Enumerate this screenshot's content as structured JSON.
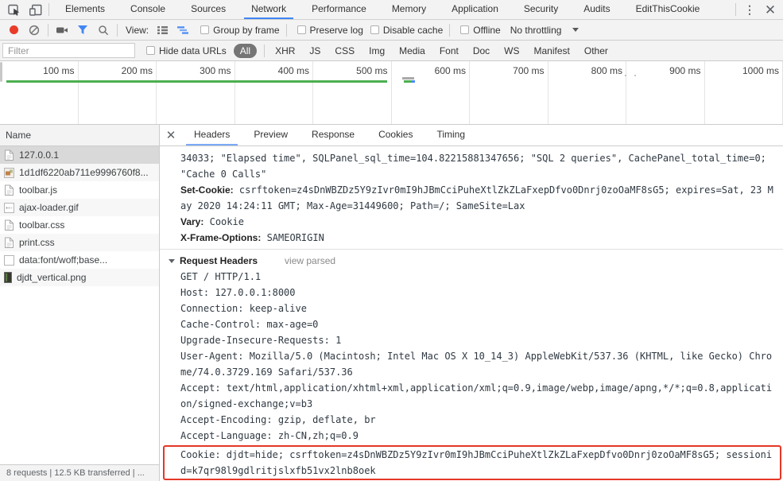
{
  "colors": {
    "accent_blue": "#4285f4",
    "record_red": "#e93b28",
    "overview_green": "#4caf50",
    "highlight_red": "#e53727",
    "selection_grey": "#d9d9d9"
  },
  "main_tabs": {
    "active": "Network",
    "items": [
      {
        "label": "Elements"
      },
      {
        "label": "Console"
      },
      {
        "label": "Sources"
      },
      {
        "label": "Network"
      },
      {
        "label": "Performance"
      },
      {
        "label": "Memory"
      },
      {
        "label": "Application"
      },
      {
        "label": "Security"
      },
      {
        "label": "Audits"
      },
      {
        "label": "EditThisCookie"
      }
    ]
  },
  "toolbar": {
    "view_label": "View:",
    "group_by_frame": "Group by frame",
    "preserve_log": "Preserve log",
    "disable_cache": "Disable cache",
    "offline": "Offline",
    "throttling": "No throttling"
  },
  "filter": {
    "placeholder": "Filter",
    "hide_data_urls": "Hide data URLs",
    "all_badge": "All",
    "types": [
      "XHR",
      "JS",
      "CSS",
      "Img",
      "Media",
      "Font",
      "Doc",
      "WS",
      "Manifest",
      "Other"
    ]
  },
  "timeline": {
    "ticks": [
      "100 ms",
      "200 ms",
      "300 ms",
      "400 ms",
      "500 ms",
      "600 ms",
      "700 ms",
      "800 ms",
      "900 ms",
      "1000 ms"
    ]
  },
  "request_list": {
    "header": "Name",
    "rows": [
      {
        "name": "127.0.0.1",
        "icon": "document-icon",
        "selected": true
      },
      {
        "name": "1d1df6220ab711e9996760f8...",
        "icon": "image-icon",
        "selected": false
      },
      {
        "name": "toolbar.js",
        "icon": "document-icon",
        "selected": false
      },
      {
        "name": "ajax-loader.gif",
        "icon": "gif-image-icon",
        "selected": false
      },
      {
        "name": "toolbar.css",
        "icon": "document-icon",
        "selected": false
      },
      {
        "name": "print.css",
        "icon": "document-icon",
        "selected": false
      },
      {
        "name": "data:font/woff;base...",
        "icon": "blank-file-icon",
        "selected": false
      },
      {
        "name": "djdt_vertical.png",
        "icon": "dark-image-icon",
        "selected": false
      }
    ]
  },
  "details": {
    "active_tab": "Headers",
    "tabs": [
      {
        "label": "Headers"
      },
      {
        "label": "Preview"
      },
      {
        "label": "Response"
      },
      {
        "label": "Cookies"
      },
      {
        "label": "Timing"
      }
    ],
    "headers_lines": [
      {
        "type": "plain",
        "text": "34033; \"Elapsed time\", SQLPanel_sql_time=104.82215881347656; \"SQL 2 queries\", CachePanel_total_time=0; \"Cache 0 Calls\""
      },
      {
        "type": "header",
        "name": "Set-Cookie:",
        "value": "csrftoken=z4sDnWBZDz5Y9zIvr0mI9hJBmCciPuheXtlZkZLaFxepDfvo0Dnrj0zoOaMF8sG5; expires=Sat, 23 May 2020 14:24:11 GMT; Max-Age=31449600; Path=/; SameSite=Lax"
      },
      {
        "type": "header",
        "name": "Vary:",
        "value": "Cookie"
      },
      {
        "type": "header",
        "name": "X-Frame-Options:",
        "value": "SAMEORIGIN"
      },
      {
        "type": "divider"
      },
      {
        "type": "section",
        "title": "Request Headers",
        "link": "view parsed"
      },
      {
        "type": "plain",
        "text": "GET / HTTP/1.1"
      },
      {
        "type": "plain",
        "text": "Host: 127.0.0.1:8000"
      },
      {
        "type": "plain",
        "text": "Connection: keep-alive"
      },
      {
        "type": "plain",
        "text": "Cache-Control: max-age=0"
      },
      {
        "type": "plain",
        "text": "Upgrade-Insecure-Requests: 1"
      },
      {
        "type": "plain",
        "text": "User-Agent: Mozilla/5.0 (Macintosh; Intel Mac OS X 10_14_3) AppleWebKit/537.36 (KHTML, like Gecko) Chrome/74.0.3729.169 Safari/537.36"
      },
      {
        "type": "plain",
        "text": "Accept: text/html,application/xhtml+xml,application/xml;q=0.9,image/webp,image/apng,*/*;q=0.8,application/signed-exchange;v=b3"
      },
      {
        "type": "plain",
        "text": "Accept-Encoding: gzip, deflate, br"
      },
      {
        "type": "plain",
        "text": "Accept-Language: zh-CN,zh;q=0.9"
      },
      {
        "type": "highlight",
        "text": "Cookie: djdt=hide; csrftoken=z4sDnWBZDz5Y9zIvr0mI9hJBmCciPuheXtlZkZLaFxepDfvo0Dnrj0zoOaMF8sG5; sessionid=k7qr98l9gdlritjslxfb51vx2lnb8oek"
      }
    ]
  },
  "status_bar": {
    "text": "8 requests | 12.5 KB transferred | ..."
  }
}
